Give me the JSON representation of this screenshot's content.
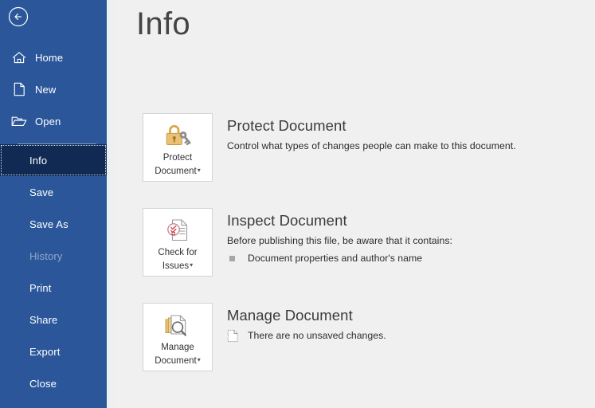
{
  "window": {
    "title": "Info",
    "back_button": "back-arrow"
  },
  "colors": {
    "sidebar_blue": "#2b579a",
    "selected_navy": "#102a54",
    "main_bg": "#f0f0f0",
    "button_bg": "#ffffff",
    "button_border": "#d4d4d4",
    "icon_gold": "#d9a441",
    "icon_gray": "#767676",
    "disabled_text": "#93a8c6",
    "title_text": "#444444"
  },
  "sidebar": {
    "top_items": [
      {
        "label": "Home",
        "icon": "home-icon",
        "state": "normal"
      },
      {
        "label": "New",
        "icon": "new-document-icon",
        "state": "normal"
      },
      {
        "label": "Open",
        "icon": "open-folder-icon",
        "state": "normal"
      }
    ],
    "list_items": [
      {
        "label": "Info",
        "state": "selected"
      },
      {
        "label": "Save",
        "state": "normal"
      },
      {
        "label": "Save As",
        "state": "normal"
      },
      {
        "label": "History",
        "state": "disabled"
      },
      {
        "label": "Print",
        "state": "normal"
      },
      {
        "label": "Share",
        "state": "normal"
      },
      {
        "label": "Export",
        "state": "normal"
      },
      {
        "label": "Close",
        "state": "normal"
      }
    ]
  },
  "main": {
    "heading": "Info",
    "sections": [
      {
        "button_line1": "Protect",
        "button_line2": "Document",
        "button_caret": "▾",
        "button_icon": "lock-and-key-icon",
        "title": "Protect Document",
        "description": "Control what types of changes people can make to this document.",
        "details": []
      },
      {
        "button_line1": "Check for",
        "button_line2": "Issues",
        "button_caret": "▾",
        "button_icon": "document-checklist-icon",
        "title": "Inspect Document",
        "description": "Before publishing this file, be aware that it contains:",
        "details": [
          {
            "icon": "square-bullet-icon",
            "text": "Document properties and author's name"
          }
        ]
      },
      {
        "button_line1": "Manage",
        "button_line2": "Document",
        "button_caret": "▾",
        "button_icon": "document-stack-search-icon",
        "title": "Manage Document",
        "description": "",
        "details": [
          {
            "icon": "dotted-document-icon",
            "text": "There are no unsaved changes."
          }
        ]
      }
    ]
  }
}
